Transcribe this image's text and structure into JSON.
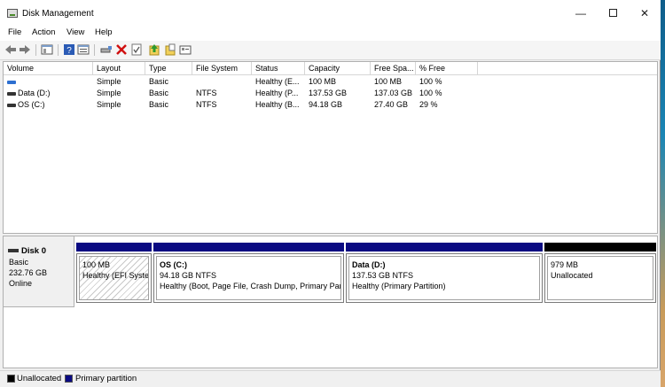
{
  "window": {
    "title": "Disk Management",
    "controls": {
      "minimize": "—",
      "maximize": "",
      "close": "✕"
    }
  },
  "menu": [
    "File",
    "Action",
    "View",
    "Help"
  ],
  "toolbar": {
    "icons": [
      "back-icon",
      "forward-icon",
      "show-hide-console-tree-icon",
      "help-icon",
      "properties-icon",
      "connect-icon",
      "delete-icon",
      "check-icon",
      "up-icon",
      "export-icon",
      "settings-icon"
    ]
  },
  "volume_table": {
    "headers": [
      "Volume",
      "Layout",
      "Type",
      "File System",
      "Status",
      "Capacity",
      "Free Spa...",
      "% Free"
    ],
    "rows": [
      {
        "volume": "",
        "layout": "Simple",
        "type": "Basic",
        "fs": "",
        "status": "Healthy (E...",
        "capacity": "100 MB",
        "free": "100 MB",
        "pct": "100 %"
      },
      {
        "volume": "Data (D:)",
        "layout": "Simple",
        "type": "Basic",
        "fs": "NTFS",
        "status": "Healthy (P...",
        "capacity": "137.53 GB",
        "free": "137.03 GB",
        "pct": "100 %"
      },
      {
        "volume": "OS (C:)",
        "layout": "Simple",
        "type": "Basic",
        "fs": "NTFS",
        "status": "Healthy (B...",
        "capacity": "94.18 GB",
        "free": "27.40 GB",
        "pct": "29 %"
      }
    ]
  },
  "disk": {
    "name": "Disk 0",
    "type": "Basic",
    "size": "232.76 GB",
    "state": "Online",
    "partitions": [
      {
        "name": "",
        "size": "100 MB",
        "status": "Healthy (EFI System Partition)",
        "kind": "primary"
      },
      {
        "name": "OS  (C:)",
        "size": "94.18 GB NTFS",
        "status": "Healthy (Boot, Page File, Crash Dump, Primary Partition)",
        "kind": "primary"
      },
      {
        "name": "Data  (D:)",
        "size": "137.53 GB NTFS",
        "status": "Healthy (Primary Partition)",
        "kind": "primary"
      },
      {
        "name": "",
        "size": "979 MB",
        "status": "Unallocated",
        "kind": "unallocated"
      }
    ]
  },
  "legend": [
    {
      "label": "Unallocated",
      "color": "#000000"
    },
    {
      "label": "Primary partition",
      "color": "#0a0a82"
    }
  ]
}
